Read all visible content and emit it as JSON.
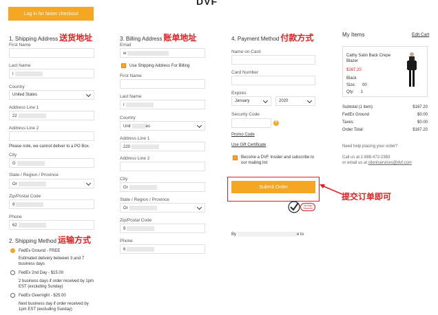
{
  "login_button": "Log in for faster checkout",
  "header_logo": "DVF",
  "shipping": {
    "title": "1. Shipping Address",
    "annotation": "送货地址",
    "first_name_label": "First Name",
    "last_name_label": "Last Name",
    "last_name_value": "I",
    "country_label": "Country",
    "country_value": "United States",
    "address1_label": "Address Line 1",
    "address1_value": "22",
    "address2_label": "Address Line 2",
    "po_note": "Please note, we cannot deliver to a PO Box.",
    "city_label": "City",
    "city_value": "G",
    "state_label": "State / Region / Province",
    "state_value": "Or",
    "zip_label": "Zip/Postal Code",
    "zip_value": "9",
    "phone_label": "Phone",
    "phone_value": "62"
  },
  "shipping_method": {
    "title": "2. Shipping Method",
    "annotation": "运输方式",
    "options": [
      {
        "label": "FedEx Ground - FREE",
        "desc": "Estimated delivery between 3 and 7 business days",
        "selected": true
      },
      {
        "label": "FedEx 2nd Day - $15.00",
        "desc": "2 business days if order received by 1pm EST (excluding Sunday)",
        "selected": false
      },
      {
        "label": "FedEx Overnight - $25.00",
        "desc": "Next business day if order received by 1pm EST (excluding Sunday)",
        "selected": false
      }
    ]
  },
  "billing": {
    "title": "3. Billing Address",
    "annotation": "账单地址",
    "email_label": "Email",
    "email_value": "w",
    "use_shipping_label": "Use Shipping Address For Billing",
    "first_name_label": "First Name",
    "last_name_label": "Last Name",
    "last_name_value": "I",
    "country_label": "Country",
    "country_value": "Unit",
    "country_value_end": "es",
    "address1_label": "Address Line 1",
    "address1_value": "220",
    "address2_label": "Address Line 2",
    "city_label": "City",
    "city_value": "Gr",
    "state_label": "State / Region / Province",
    "state_value": "Or",
    "zip_label": "Zip/Postal Code",
    "zip_value": "9",
    "phone_label": "Phone",
    "phone_value": "6"
  },
  "payment": {
    "title": "4. Payment Method",
    "annotation": "付款方式",
    "name_label": "Name on Card",
    "number_label": "Card Number",
    "expires_label": "Expires",
    "month_value": "January",
    "year_value": "2020",
    "cvv_label": "Security Code",
    "help_glyph": "?",
    "promo_link": "Promo Code",
    "gift_link": "Use Gift Certificate",
    "insider_label": "Become a DVF Insider and subscribe to our mailing list",
    "submit_label": "Submit Order",
    "submit_annotation": "提交订单即可",
    "badge_line1": "VeriSign",
    "badge_line2": "Secured",
    "by_text": "By",
    "by_text_end": "e to"
  },
  "items": {
    "title": "My Items",
    "edit_link": "Edit Cart",
    "product_name": "Cathy Satin Back Crepe Blazer",
    "price": "$167.20",
    "color": "Black",
    "size_label": "Size:",
    "size_value": "00",
    "qty_label": "Qty:",
    "qty_value": "1",
    "summary": [
      {
        "label": "Subtotal (1 item)",
        "value": "$167.20"
      },
      {
        "label": "FedEx Ground",
        "value": "$0.00"
      },
      {
        "label": "Taxes:",
        "value": "$0.00"
      },
      {
        "label": "Order Total:",
        "value": "$167.20"
      }
    ],
    "help_title": "Need help placing your order?",
    "help_line1": "Call us at 1-888-472-2383",
    "help_line2_prefix": "or email us at",
    "help_email": "clientservices@dvf.com"
  },
  "colors": {
    "accent": "#f5a623",
    "annotation": "#e02020"
  }
}
